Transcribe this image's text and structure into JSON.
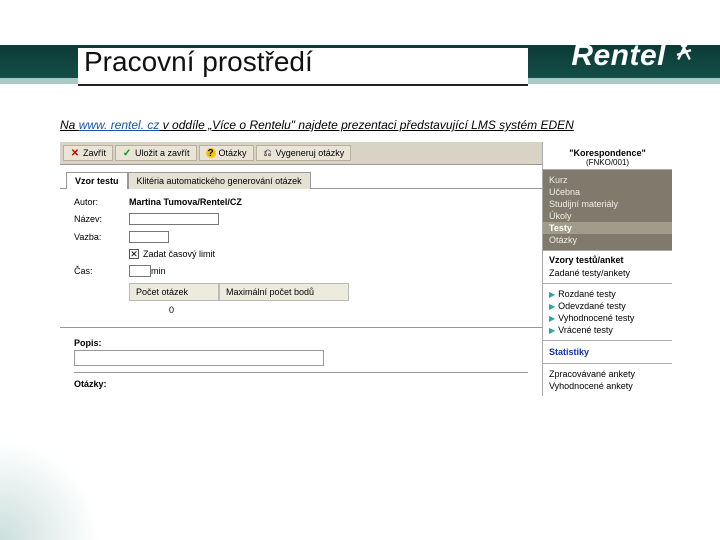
{
  "slide": {
    "title": "Pracovní prostředí"
  },
  "brand": "Rentel",
  "caption": {
    "prefix": "Na ",
    "link": "www. rentel. cz",
    "rest": " v oddíle „Více o Rentelu\" najdete prezentaci představující   LMS systém EDEN"
  },
  "toolbar": {
    "close": "Zavřít",
    "saveClose": "Uložit a zavřít",
    "questions": "Otázky",
    "generate": "Vygeneruj otázky"
  },
  "tabs": {
    "t1": "Vzor testu",
    "t2": "Klitéria automatického generování otázek"
  },
  "form": {
    "authorLbl": "Autor:",
    "author": "Martina Tumova/Rentel/CZ",
    "nameLbl": "Název:",
    "bindLbl": "Vazba:",
    "timeLimit": "Zadat časový limit",
    "timeLbl": "Čas:",
    "timeUnit": "min",
    "colCount": "Počet otázek",
    "colMax": "Maximální počet bodů",
    "zero": "0",
    "descLbl": "Popis:",
    "qLbl": "Otázky:"
  },
  "side": {
    "courseTitle": "\"Korespondence\"",
    "courseCode": "(FNKO/001)",
    "nav": {
      "kurz": "Kurz",
      "ucebna": "Učebna",
      "materialy": "Studijní materiály",
      "ukoly": "Úkoly",
      "testy": "Testy",
      "otazky": "Otázky"
    },
    "sec1": {
      "h": "Vzory testů/anket",
      "i1": "Zadané testy/ankety"
    },
    "sec2": {
      "i1": "Rozdané testy",
      "i2": "Odevzdané testy",
      "i3": "Vyhodnocené testy",
      "i4": "Vrácené testy"
    },
    "sec3": {
      "h": "Statistiky",
      "i1": "Zpracovávané ankety",
      "i2": "Vyhodnocené ankety"
    }
  }
}
